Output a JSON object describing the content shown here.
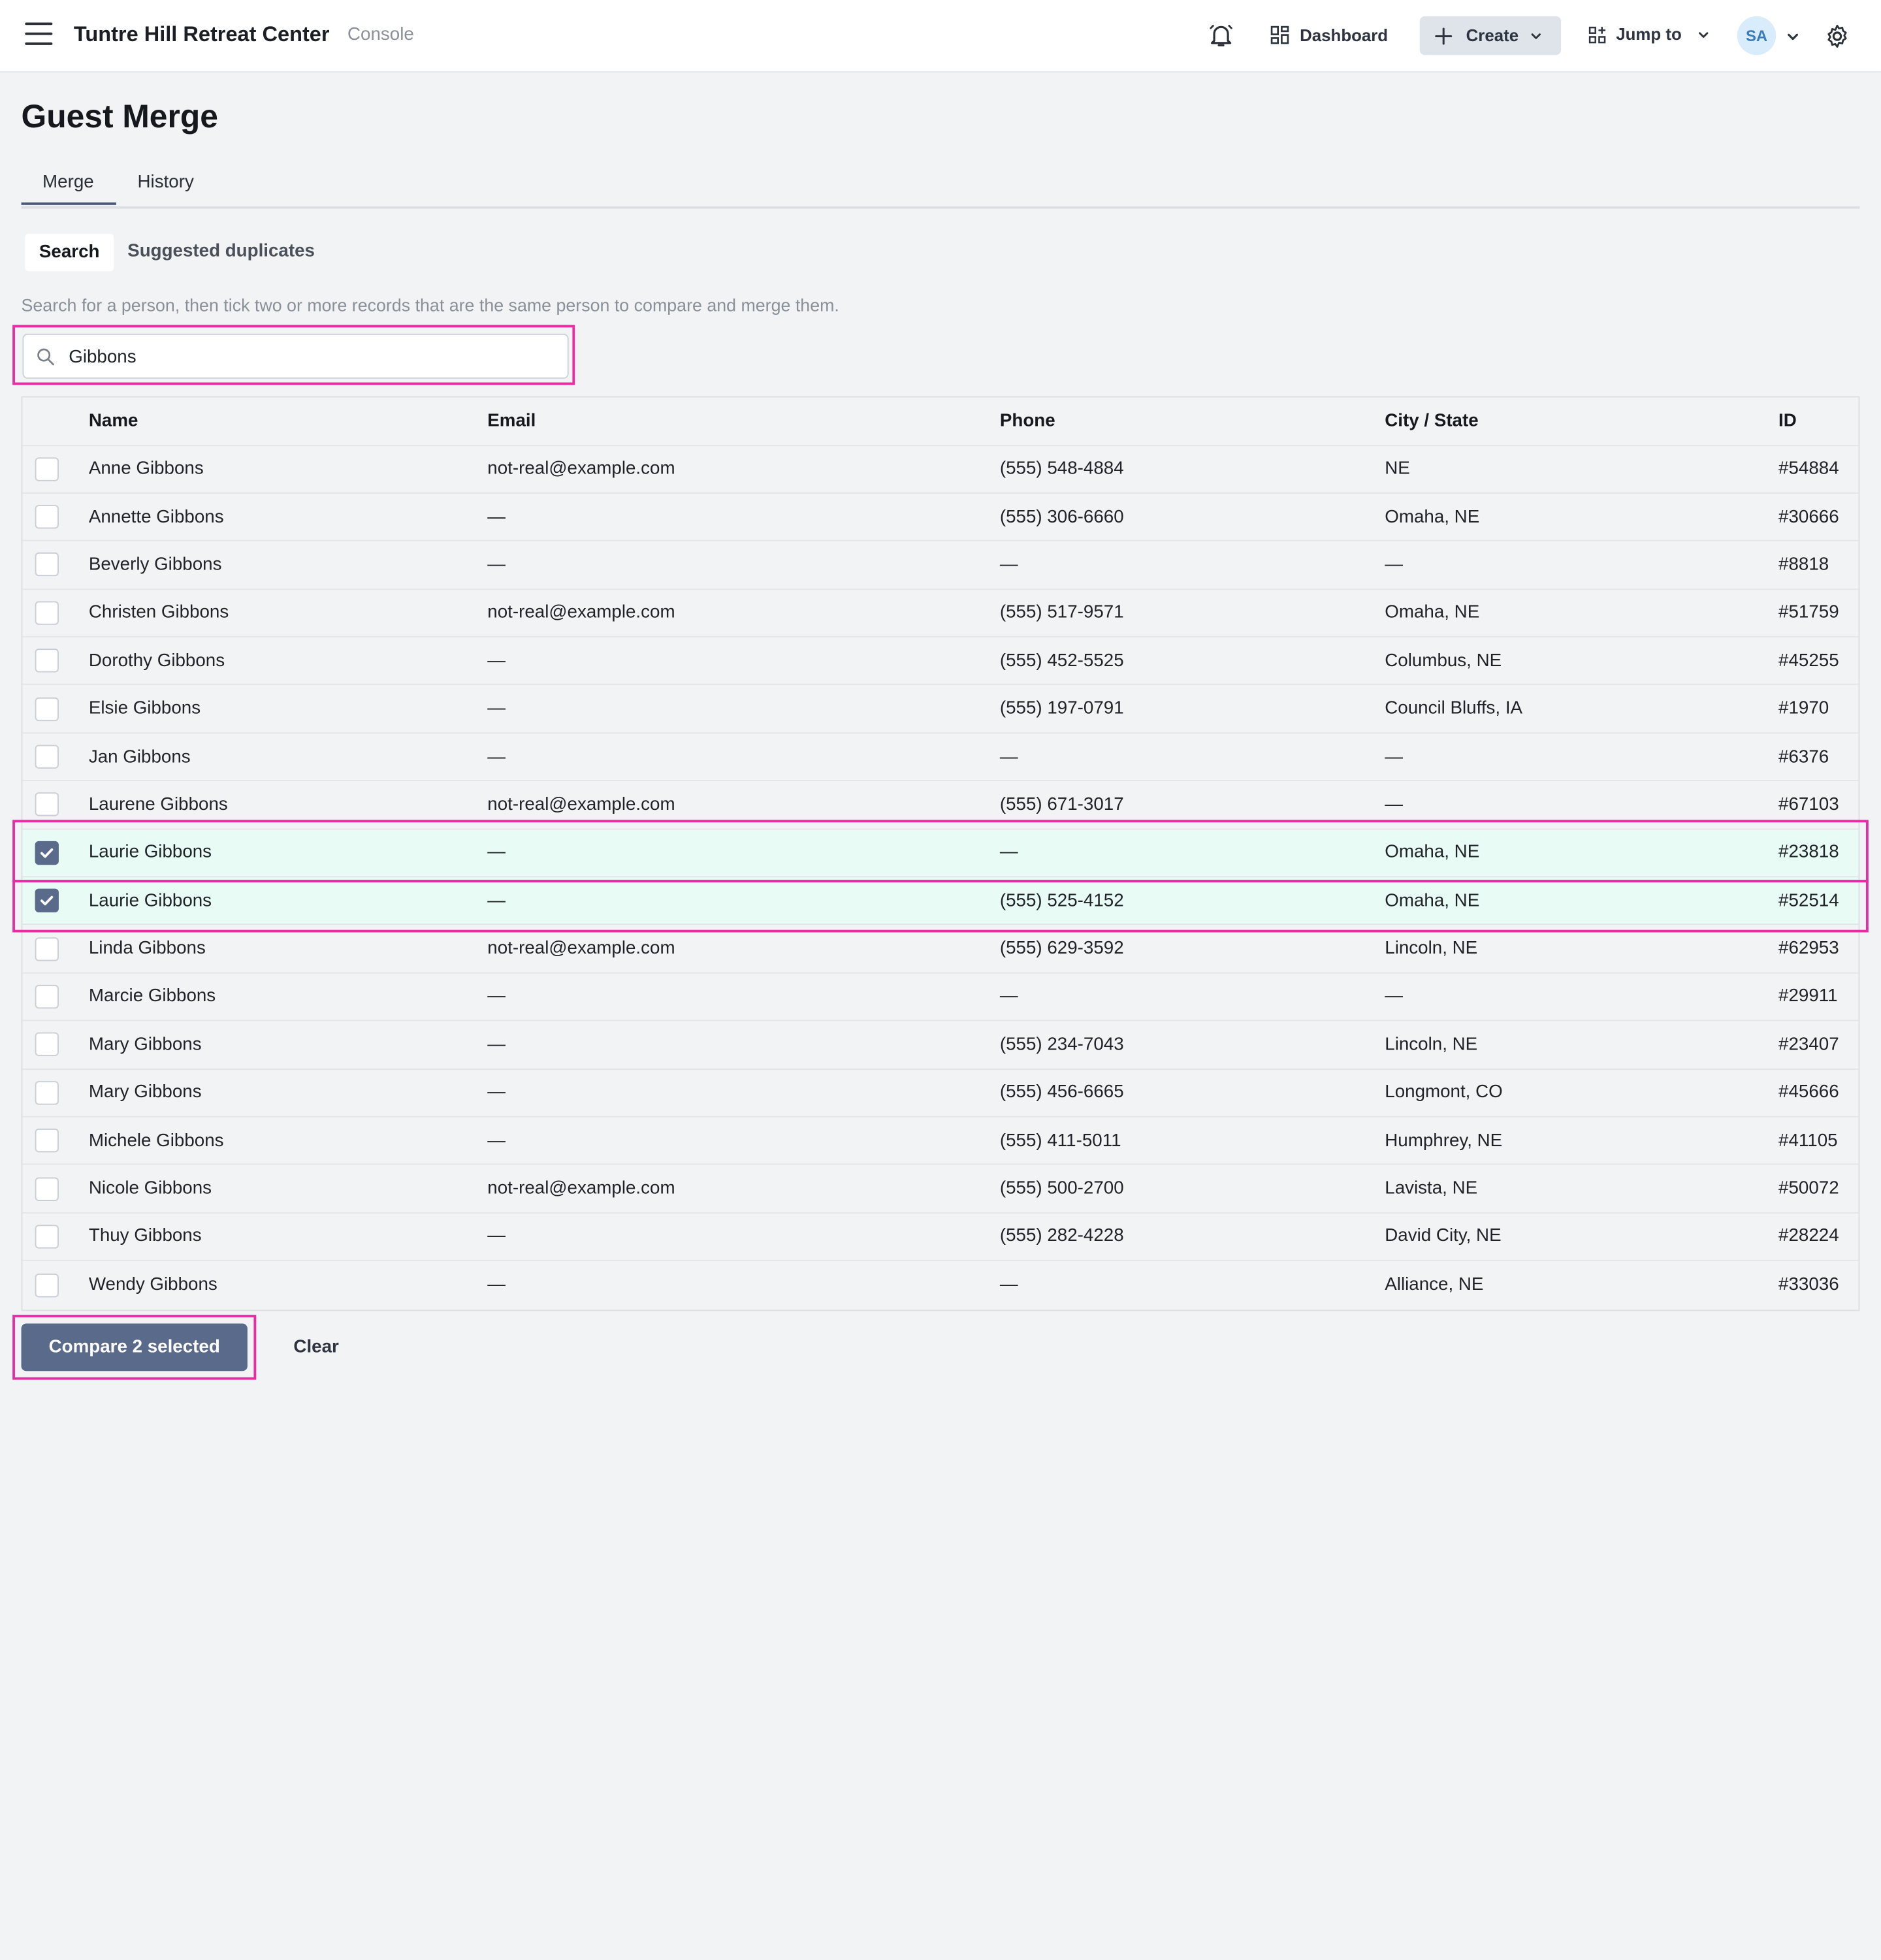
{
  "header": {
    "brand": "Tuntre Hill Retreat Center",
    "brand_sub": "Console",
    "dashboard_label": "Dashboard",
    "create_label": "Create",
    "jump_label": "Jump to",
    "avatar_initials": "SA"
  },
  "page": {
    "title": "Guest Merge",
    "tabs": [
      {
        "label": "Merge"
      },
      {
        "label": "History"
      }
    ],
    "subtabs": [
      {
        "label": "Search"
      },
      {
        "label": "Suggested duplicates"
      }
    ],
    "helper": "Search for a person, then tick two or more records that are the same person to compare and merge them."
  },
  "search": {
    "value": "Gibbons"
  },
  "table": {
    "columns": [
      "Name",
      "Email",
      "Phone",
      "City / State",
      "ID"
    ],
    "rows": [
      {
        "name": "Anne Gibbons",
        "email": "not-real@example.com",
        "phone": "(555) 548-4884",
        "city": "NE",
        "id": "#54884",
        "checked": false
      },
      {
        "name": "Annette Gibbons",
        "email": "—",
        "phone": "(555) 306-6660",
        "city": "Omaha, NE",
        "id": "#30666",
        "checked": false
      },
      {
        "name": "Beverly Gibbons",
        "email": "—",
        "phone": "—",
        "city": "—",
        "id": "#8818",
        "checked": false
      },
      {
        "name": "Christen Gibbons",
        "email": "not-real@example.com",
        "phone": "(555) 517-9571",
        "city": "Omaha, NE",
        "id": "#51759",
        "checked": false
      },
      {
        "name": "Dorothy Gibbons",
        "email": "—",
        "phone": "(555) 452-5525",
        "city": "Columbus, NE",
        "id": "#45255",
        "checked": false
      },
      {
        "name": "Elsie Gibbons",
        "email": "—",
        "phone": "(555) 197-0791",
        "city": "Council Bluffs, IA",
        "id": "#1970",
        "checked": false
      },
      {
        "name": "Jan Gibbons",
        "email": "—",
        "phone": "—",
        "city": "—",
        "id": "#6376",
        "checked": false
      },
      {
        "name": "Laurene Gibbons",
        "email": "not-real@example.com",
        "phone": "(555) 671-3017",
        "city": "—",
        "id": "#67103",
        "checked": false
      },
      {
        "name": "Laurie Gibbons",
        "email": "—",
        "phone": "—",
        "city": "Omaha, NE",
        "id": "#23818",
        "checked": true
      },
      {
        "name": "Laurie Gibbons",
        "email": "—",
        "phone": "(555) 525-4152",
        "city": "Omaha, NE",
        "id": "#52514",
        "checked": true
      },
      {
        "name": "Linda Gibbons",
        "email": "not-real@example.com",
        "phone": "(555) 629-3592",
        "city": "Lincoln, NE",
        "id": "#62953",
        "checked": false
      },
      {
        "name": "Marcie Gibbons",
        "email": "—",
        "phone": "—",
        "city": "—",
        "id": "#29911",
        "checked": false
      },
      {
        "name": "Mary Gibbons",
        "email": "—",
        "phone": "(555) 234-7043",
        "city": "Lincoln, NE",
        "id": "#23407",
        "checked": false
      },
      {
        "name": "Mary Gibbons",
        "email": "—",
        "phone": "(555) 456-6665",
        "city": "Longmont, CO",
        "id": "#45666",
        "checked": false
      },
      {
        "name": "Michele Gibbons",
        "email": "—",
        "phone": "(555) 411-5011",
        "city": "Humphrey, NE",
        "id": "#41105",
        "checked": false
      },
      {
        "name": "Nicole Gibbons",
        "email": "not-real@example.com",
        "phone": "(555) 500-2700",
        "city": "Lavista, NE",
        "id": "#50072",
        "checked": false
      },
      {
        "name": "Thuy Gibbons",
        "email": "—",
        "phone": "(555) 282-4228",
        "city": "David City, NE",
        "id": "#28224",
        "checked": false
      },
      {
        "name": "Wendy Gibbons",
        "email": "—",
        "phone": "—",
        "city": "Alliance, NE",
        "id": "#33036",
        "checked": false
      }
    ]
  },
  "actions": {
    "compare_label": "Compare 2 selected",
    "clear_label": "Clear"
  },
  "colors": {
    "accent": "#5a6a8a",
    "highlight": "#e62ea3",
    "selected_row": "#e8fbf4"
  },
  "icons": [
    "menu-icon",
    "bell-icon",
    "dashboard-icon",
    "plus-icon",
    "chevron-down-icon",
    "jump-icon",
    "gear-icon",
    "search-icon",
    "check-icon"
  ]
}
